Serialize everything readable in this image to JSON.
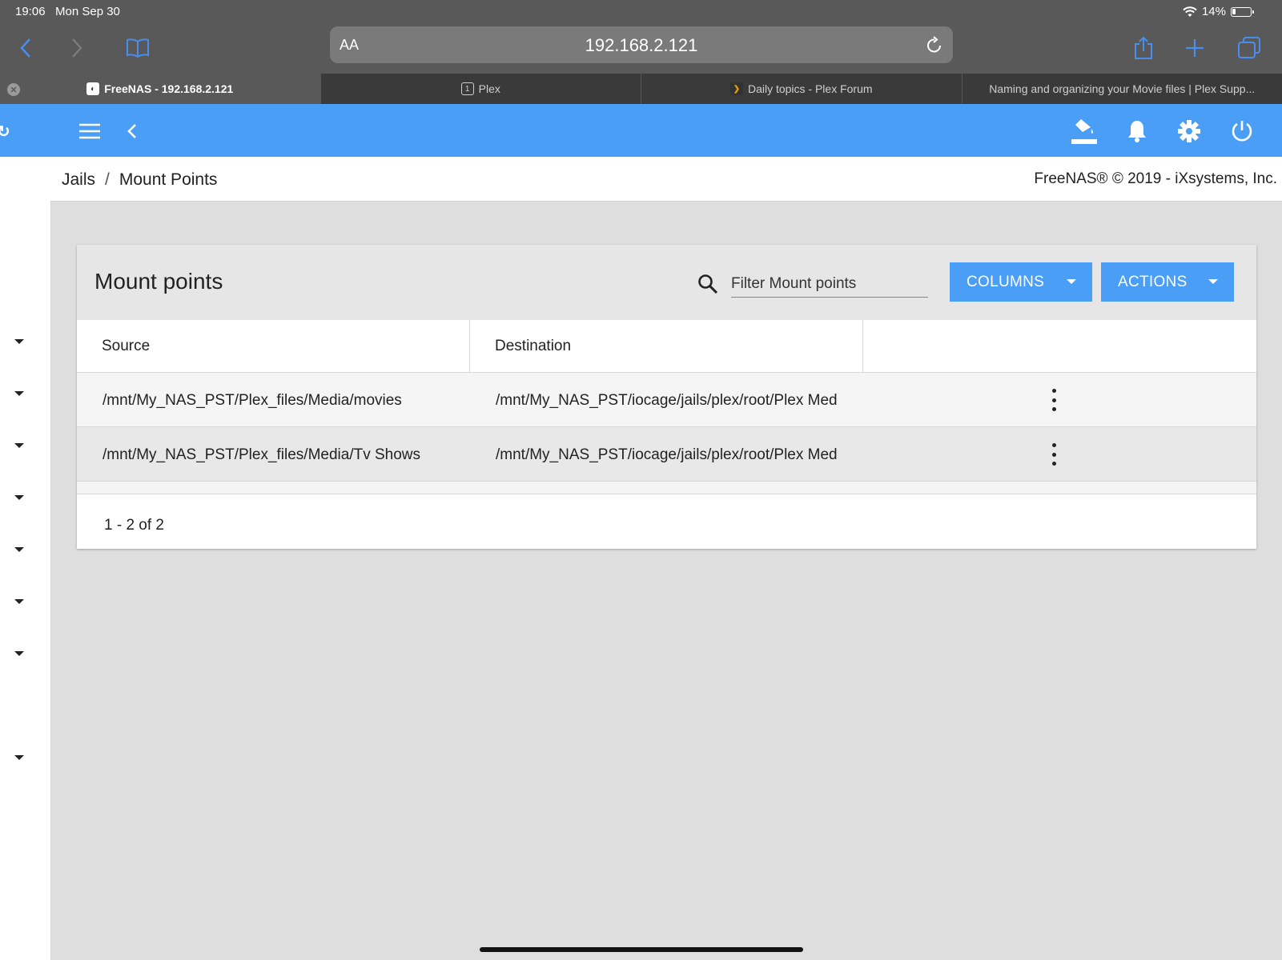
{
  "status_bar": {
    "time": "19:06",
    "date": "Mon Sep 30",
    "battery": "14%"
  },
  "browser": {
    "aa_label": "AA",
    "url": "192.168.2.121",
    "tabs": [
      {
        "label": "FreeNAS - 192.168.2.121",
        "favicon": "freenas-favicon",
        "active": true
      },
      {
        "label": "Plex",
        "favicon": "plex-favicon",
        "active": false
      },
      {
        "label": "Daily topics - Plex Forum",
        "favicon": "plex-forum-favicon",
        "active": false
      },
      {
        "label": "Naming and organizing your Movie files | Plex Supp...",
        "favicon": "",
        "active": false
      }
    ],
    "chrome_color": "#595959"
  },
  "app": {
    "accent": "#4a9ef5",
    "breadcrumb": {
      "parent": "Jails",
      "separator": "/",
      "current": "Mount Points"
    },
    "copyright": "FreeNAS® © 2019 - iXsystems, Inc.",
    "topbar_icons": [
      "menu-icon",
      "back-chevron-icon",
      "theme-paint-icon",
      "bell-icon",
      "gear-icon",
      "power-icon"
    ]
  },
  "card": {
    "title": "Mount points",
    "filter_placeholder": "Filter Mount points",
    "columns_button": "COLUMNS",
    "actions_button": "ACTIONS",
    "headers": [
      "Source",
      "Destination",
      ""
    ],
    "rows": [
      {
        "source": "/mnt/My_NAS_PST/Plex_files/Media/movies",
        "destination": "/mnt/My_NAS_PST/iocage/jails/plex/root/Plex Med"
      },
      {
        "source": "/mnt/My_NAS_PST/Plex_files/Media/Tv Shows",
        "destination": "/mnt/My_NAS_PST/iocage/jails/plex/root/Plex Med"
      }
    ],
    "pagination": "1 - 2 of 2"
  }
}
